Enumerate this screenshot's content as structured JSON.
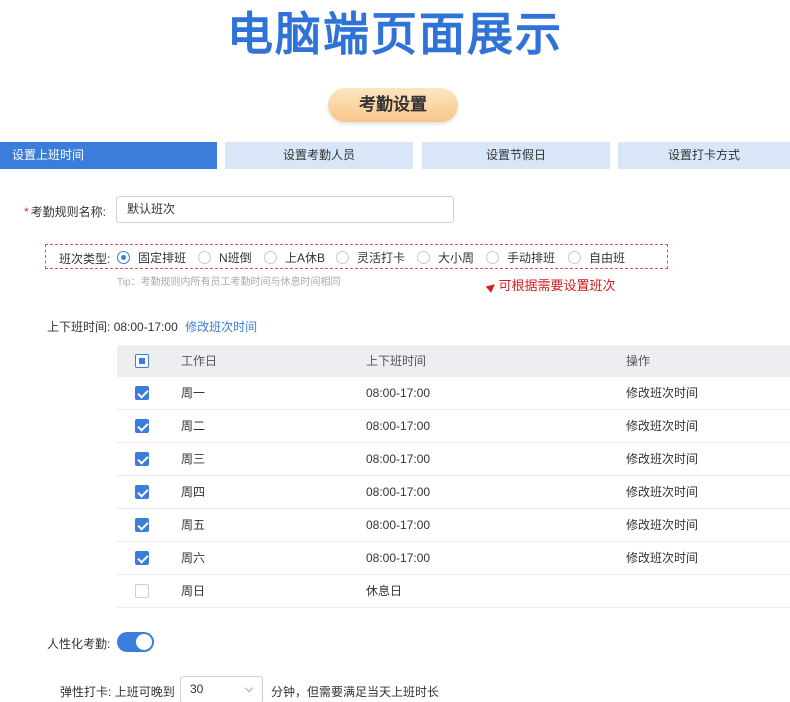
{
  "banner": {
    "title": "电脑端页面展示"
  },
  "section_pill": "考勤设置",
  "tabs": [
    {
      "label": "设置上班时间",
      "active": true
    },
    {
      "label": "设置考勤人员",
      "active": false
    },
    {
      "label": "设置节假日",
      "active": false
    },
    {
      "label": "设置打卡方式",
      "active": false
    }
  ],
  "rule_name": {
    "required_mark": "*",
    "label": "考勤规则名称:",
    "value": "默认班次"
  },
  "shift_type": {
    "label": "班次类型:",
    "options": [
      {
        "label": "固定排班",
        "checked": true
      },
      {
        "label": "N班倒",
        "checked": false
      },
      {
        "label": "上A休B",
        "checked": false
      },
      {
        "label": "灵活打卡",
        "checked": false
      },
      {
        "label": "大小周",
        "checked": false
      },
      {
        "label": "手动排班",
        "checked": false
      },
      {
        "label": "自由班",
        "checked": false
      }
    ],
    "tip": "Tip：考勤规则内所有员工考勤时间与休息时间相同",
    "note": "可根据需要设置班次"
  },
  "hours": {
    "label": "上下班时间:",
    "value": "08:00-17:00",
    "edit_link": "修改班次时间"
  },
  "schedule_table": {
    "headers": {
      "day": "工作日",
      "hours": "上下班时间",
      "action": "操作"
    },
    "rows": [
      {
        "day": "周一",
        "hours": "08:00-17:00",
        "action": "修改班次时间",
        "checked": true
      },
      {
        "day": "周二",
        "hours": "08:00-17:00",
        "action": "修改班次时间",
        "checked": true
      },
      {
        "day": "周三",
        "hours": "08:00-17:00",
        "action": "修改班次时间",
        "checked": true
      },
      {
        "day": "周四",
        "hours": "08:00-17:00",
        "action": "修改班次时间",
        "checked": true
      },
      {
        "day": "周五",
        "hours": "08:00-17:00",
        "action": "修改班次时间",
        "checked": true
      },
      {
        "day": "周六",
        "hours": "08:00-17:00",
        "action": "修改班次时间",
        "checked": true
      },
      {
        "day": "周日",
        "hours": "休息日",
        "action": "",
        "checked": false
      }
    ]
  },
  "humanized": {
    "label": "人性化考勤:",
    "enabled": true
  },
  "flex_clock": {
    "label": "弹性打卡:",
    "prefix": "上班可晚到",
    "selected": "30",
    "suffix": "分钟，但需要满足当天上班时长"
  },
  "colors": {
    "primary": "#3b7ddb",
    "banner": "#2f72d8",
    "tab_inactive": "#d9e6f7",
    "note": "#d42020"
  }
}
